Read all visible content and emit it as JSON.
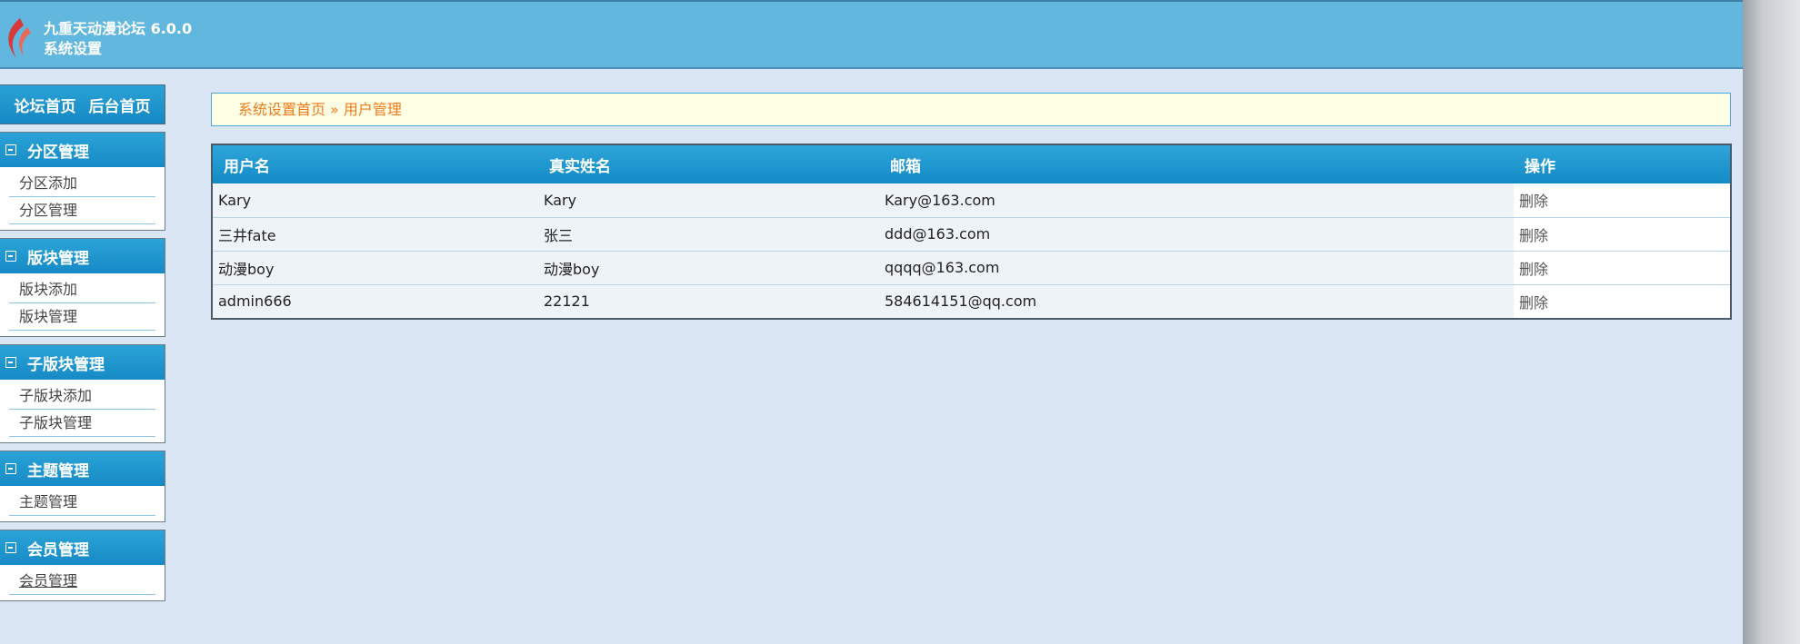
{
  "header": {
    "title": "九重天动漫论坛 6.0.0",
    "subtitle": "系统设置"
  },
  "colors": {
    "header_bg": "#62b7de",
    "accent": "#1689c5",
    "breadcrumb_text": "#f07a18",
    "content_bg": "#dae6f3"
  },
  "sidebar": {
    "top_links": [
      "论坛首页",
      "后台首页"
    ],
    "groups": [
      {
        "title": "分区管理",
        "items": [
          "分区添加",
          "分区管理"
        ]
      },
      {
        "title": "版块管理",
        "items": [
          "版块添加",
          "版块管理"
        ]
      },
      {
        "title": "子版块管理",
        "items": [
          "子版块添加",
          "子版块管理"
        ]
      },
      {
        "title": "主题管理",
        "items": [
          "主题管理"
        ]
      },
      {
        "title": "会员管理",
        "items": [
          "会员管理"
        ]
      }
    ]
  },
  "breadcrumb": {
    "home": "系统设置首页",
    "separator": "»",
    "current": "用户管理"
  },
  "table": {
    "columns": [
      "用户名",
      "真实姓名",
      "邮箱",
      "操作"
    ],
    "rows": [
      [
        "Kary",
        "Kary",
        "Kary@163.com",
        "删除"
      ],
      [
        "三井fate",
        "张三",
        "ddd@163.com",
        "删除"
      ],
      [
        "动漫boy",
        "动漫boy",
        "qqqq@163.com",
        "删除"
      ],
      [
        "admin666",
        "22121",
        "584614151@qq.com",
        "删除"
      ]
    ]
  }
}
